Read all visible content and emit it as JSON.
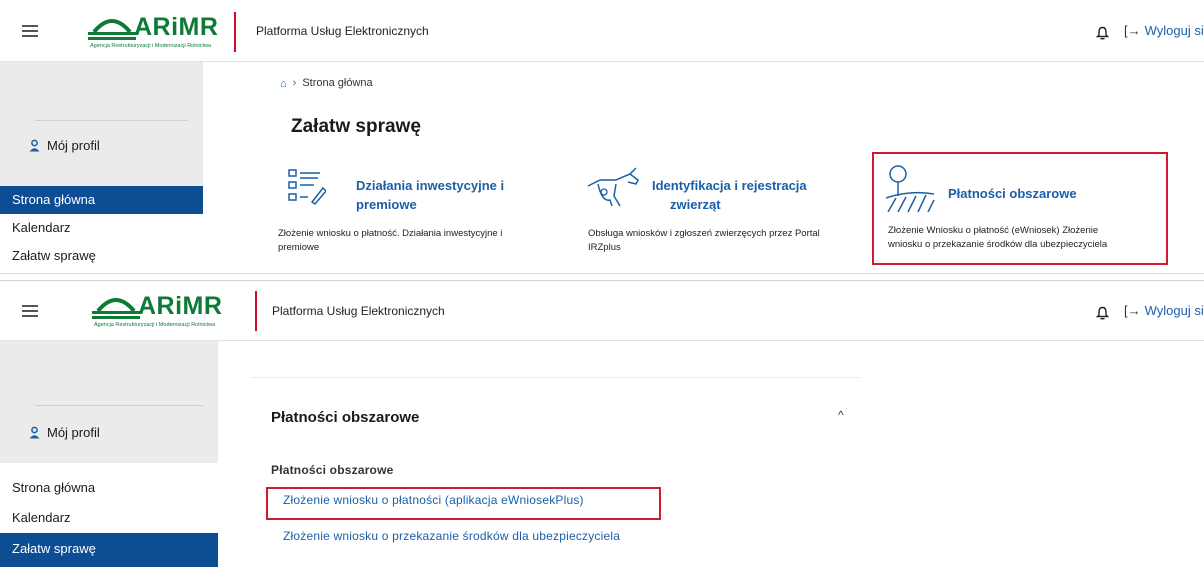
{
  "header": {
    "logo_text": "ARiMR",
    "logo_tagline": "Agencja Restrukturyzacji i Modernizacji Rolnictwa",
    "platform_name": "Platforma Usług Elektronicznych",
    "logout_label": "Wyloguj się",
    "icons": [
      "hamburger-menu-icon",
      "bell-icon",
      "logout-icon"
    ]
  },
  "sidebar": {
    "profile_label": "Mój profil",
    "items": [
      {
        "label": "Strona główna"
      },
      {
        "label": "Kalendarz"
      },
      {
        "label": "Załatw sprawę"
      }
    ]
  },
  "top_view": {
    "breadcrumb": {
      "home_icon": "home-icon",
      "current": "Strona główna"
    },
    "page_title": "Załatw sprawę",
    "cards": [
      {
        "title_line1": "Działania inwestycyjne i",
        "title_line2": "premiowe",
        "desc_line1": "Złożenie wniosku o płatność. Działania inwestycyjne i",
        "desc_line2": "premiowe",
        "icon": "checklist-icon"
      },
      {
        "title_line1": "Identyfikacja i rejestracja",
        "title_line2": "zwierząt",
        "desc_line1": "Obsługa wniosków i zgłoszeń zwierzęcych przez Portal",
        "desc_line2": "IRZplus",
        "icon": "cow-icon"
      },
      {
        "title_line1": "Płatności obszarowe",
        "desc_line1": "Złożenie Wniosku o płatność (eWniosek) Złożenie",
        "desc_line2": "wniosku o przekazanie środków dla ubezpieczyciela",
        "icon": "field-tree-icon"
      }
    ]
  },
  "bottom_view": {
    "accordion_title": "Płatności obszarowe",
    "section_heading": "Płatności obszarowe",
    "links": [
      {
        "label": "Złożenie wniosku o płatności (aplikacja eWniosekPlus)"
      },
      {
        "label": "Złożenie wniosku o przekazanie środków dla ubezpieczyciela"
      }
    ]
  },
  "colors": {
    "brand_green": "#0d7a36",
    "link_blue": "#1b5fa8",
    "nav_active": "#0d4d94",
    "highlight_red": "#d1192f",
    "sidebar_bg": "#ebebeb"
  }
}
